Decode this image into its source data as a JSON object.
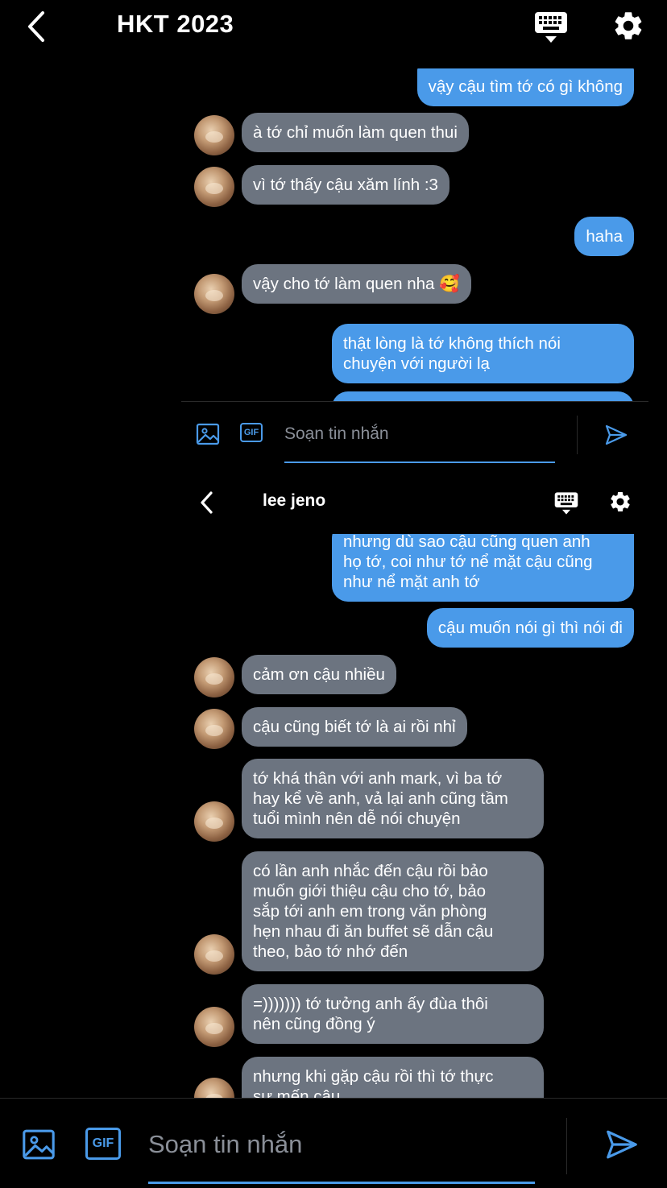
{
  "outer": {
    "title": "HKT 2023",
    "icons": [
      "back-chevron-icon",
      "keyboard-icon",
      "gear-icon"
    ]
  },
  "outer_messages": [
    {
      "from": "me",
      "text": "vậy cậu tìm tớ có gì không"
    },
    {
      "from": "them",
      "text": "à tớ chỉ muốn làm quen thui"
    },
    {
      "from": "them",
      "text": "vì tớ thấy cậu xăm lính :3"
    },
    {
      "from": "me",
      "text": "haha"
    },
    {
      "from": "them",
      "text": "vậy cho tớ làm quen nha 🥰"
    },
    {
      "from": "me",
      "text": "thật lòng là tớ không thích nói\nchuyện với người lạ"
    }
  ],
  "inner": {
    "title": "lee jeno",
    "icons": [
      "back-chevron-icon",
      "keyboard-icon",
      "gear-icon"
    ]
  },
  "inner_messages": [
    {
      "from": "me",
      "text": "nhưng dù sao cậu cũng quen anh\nhọ tớ, coi như tớ nể mặt cậu cũng\nnhư nể mặt anh tớ"
    },
    {
      "from": "me",
      "text": "cậu muốn nói gì thì nói đi"
    },
    {
      "from": "them",
      "text": "cảm ơn cậu nhiều"
    },
    {
      "from": "them",
      "text": "cậu cũng biết tớ là ai rồi nhỉ"
    },
    {
      "from": "them",
      "text": "tớ khá thân với anh mark, vì ba tớ\nhay kể về anh, vả lại anh cũng tầm\ntuổi mình nên dễ nói chuyện"
    },
    {
      "from": "them",
      "text": "có lần anh nhắc đến cậu rồi bảo\nmuốn giới thiệu cậu cho tớ, bảo\nsắp tới anh em trong văn phòng\nhẹn nhau đi ăn buffet sẽ dẫn cậu\ntheo, bảo tớ nhớ đến"
    },
    {
      "from": "them",
      "text": "=))))))) tớ tưởng anh ấy đùa thôi\nnên cũng đồng ý"
    },
    {
      "from": "them",
      "text": "nhưng khi gặp cậu rồi thì tớ thực\nsự mến cậu"
    }
  ],
  "composer_inner": {
    "placeholder": "Soạn tin nhắn",
    "gif_label": "GIF",
    "icons": [
      "image-icon",
      "gif-icon",
      "send-icon"
    ]
  },
  "composer_outer": {
    "placeholder": "Soạn tin nhắn",
    "gif_label": "GIF",
    "icons": [
      "image-icon",
      "gif-icon",
      "send-icon"
    ]
  },
  "colors": {
    "background": "#000000",
    "sent_bubble": "#4a9ae9",
    "received_bubble": "#6c7480",
    "accent": "#4a9ae9"
  }
}
